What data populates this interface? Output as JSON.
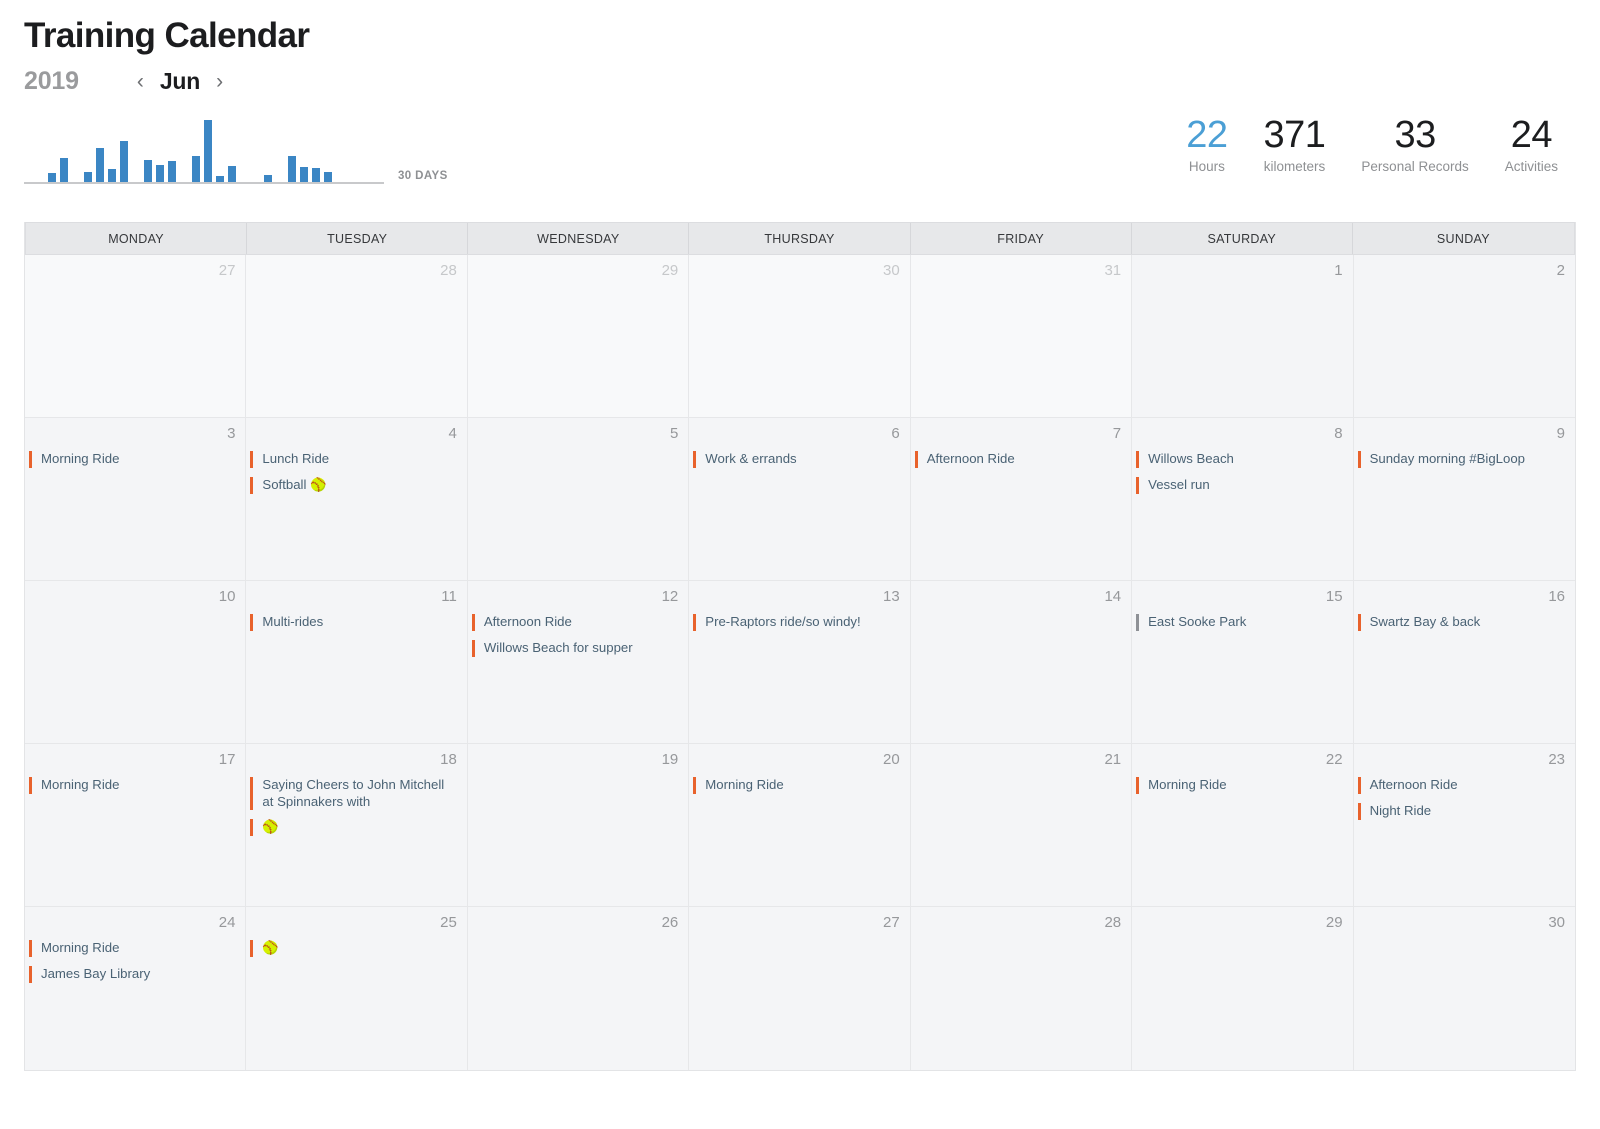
{
  "header": {
    "title": "Training Calendar",
    "year": "2019",
    "month": "Jun",
    "prev_icon": "‹",
    "next_icon": "›",
    "sparkline_label": "30 DAYS"
  },
  "stats": [
    {
      "value": "22",
      "label": "Hours",
      "accent": true,
      "color": "#4b9fd5"
    },
    {
      "value": "371",
      "label": "kilometers",
      "accent": false,
      "color": "#1c1d1f"
    },
    {
      "value": "33",
      "label": "Personal Records",
      "accent": false,
      "color": "#1c1d1f"
    },
    {
      "value": "24",
      "label": "Activities",
      "accent": false,
      "color": "#1c1d1f"
    }
  ],
  "chart_data": {
    "type": "bar",
    "title": "30 DAYS",
    "xlabel": "",
    "ylabel": "",
    "grid": false,
    "legend": "none",
    "categories": [
      "1",
      "2",
      "3",
      "4",
      "5",
      "6",
      "7",
      "8",
      "9",
      "10",
      "11",
      "12",
      "13",
      "14",
      "15",
      "16",
      "17",
      "18",
      "19",
      "20",
      "21",
      "22",
      "23",
      "24",
      "25",
      "26",
      "27",
      "28",
      "29",
      "30"
    ],
    "values": [
      0,
      0,
      8,
      22,
      0,
      9,
      32,
      12,
      38,
      0,
      21,
      16,
      20,
      0,
      24,
      58,
      6,
      15,
      0,
      0,
      7,
      0,
      24,
      14,
      13,
      9,
      0,
      0,
      0,
      0
    ],
    "ylim": [
      0,
      58
    ],
    "color": "#3b86c4"
  },
  "weekdays": [
    "MONDAY",
    "TUESDAY",
    "WEDNESDAY",
    "THURSDAY",
    "FRIDAY",
    "SATURDAY",
    "SUNDAY"
  ],
  "weeks": [
    [
      {
        "num": "27",
        "other": true,
        "events": []
      },
      {
        "num": "28",
        "other": true,
        "events": []
      },
      {
        "num": "29",
        "other": true,
        "events": []
      },
      {
        "num": "30",
        "other": true,
        "events": []
      },
      {
        "num": "31",
        "other": true,
        "events": []
      },
      {
        "num": "1",
        "other": false,
        "events": []
      },
      {
        "num": "2",
        "other": false,
        "events": []
      }
    ],
    [
      {
        "num": "3",
        "other": false,
        "events": [
          {
            "text": "Morning Ride",
            "color": "orange"
          }
        ]
      },
      {
        "num": "4",
        "other": false,
        "events": [
          {
            "text": "Lunch Ride",
            "color": "orange"
          },
          {
            "text": "Softball 🥎",
            "color": "orange"
          }
        ]
      },
      {
        "num": "5",
        "other": false,
        "events": []
      },
      {
        "num": "6",
        "other": false,
        "events": [
          {
            "text": "Work & errands",
            "color": "orange"
          }
        ]
      },
      {
        "num": "7",
        "other": false,
        "events": [
          {
            "text": "Afternoon Ride",
            "color": "orange"
          }
        ]
      },
      {
        "num": "8",
        "other": false,
        "events": [
          {
            "text": "Willows Beach",
            "color": "orange"
          },
          {
            "text": "Vessel run",
            "color": "orange"
          }
        ]
      },
      {
        "num": "9",
        "other": false,
        "events": [
          {
            "text": "Sunday morning #BigLoop",
            "color": "orange"
          }
        ]
      }
    ],
    [
      {
        "num": "10",
        "other": false,
        "events": []
      },
      {
        "num": "11",
        "other": false,
        "events": [
          {
            "text": "Multi-rides",
            "color": "orange"
          }
        ]
      },
      {
        "num": "12",
        "other": false,
        "events": [
          {
            "text": "Afternoon Ride",
            "color": "orange"
          },
          {
            "text": "Willows Beach for supper",
            "color": "orange"
          }
        ]
      },
      {
        "num": "13",
        "other": false,
        "events": [
          {
            "text": "Pre-Raptors ride/so windy!",
            "color": "orange"
          }
        ]
      },
      {
        "num": "14",
        "other": false,
        "events": []
      },
      {
        "num": "15",
        "other": false,
        "events": [
          {
            "text": "East Sooke Park",
            "color": "gray"
          }
        ]
      },
      {
        "num": "16",
        "other": false,
        "events": [
          {
            "text": "Swartz Bay & back",
            "color": "orange"
          }
        ]
      }
    ],
    [
      {
        "num": "17",
        "other": false,
        "events": [
          {
            "text": "Morning Ride",
            "color": "orange"
          }
        ]
      },
      {
        "num": "18",
        "other": false,
        "events": [
          {
            "text": "Saying Cheers to John Mitchell at Spinnakers with",
            "color": "orange"
          },
          {
            "text": "🥎",
            "color": "orange"
          }
        ]
      },
      {
        "num": "19",
        "other": false,
        "events": []
      },
      {
        "num": "20",
        "other": false,
        "events": [
          {
            "text": "Morning Ride",
            "color": "orange"
          }
        ]
      },
      {
        "num": "21",
        "other": false,
        "events": []
      },
      {
        "num": "22",
        "other": false,
        "events": [
          {
            "text": "Morning Ride",
            "color": "orange"
          }
        ]
      },
      {
        "num": "23",
        "other": false,
        "events": [
          {
            "text": "Afternoon Ride",
            "color": "orange"
          },
          {
            "text": "Night Ride",
            "color": "orange"
          }
        ]
      }
    ],
    [
      {
        "num": "24",
        "other": false,
        "events": [
          {
            "text": "Morning Ride",
            "color": "orange"
          },
          {
            "text": "James Bay Library",
            "color": "orange"
          }
        ]
      },
      {
        "num": "25",
        "other": false,
        "events": [
          {
            "text": "🥎",
            "color": "orange"
          }
        ]
      },
      {
        "num": "26",
        "other": false,
        "events": []
      },
      {
        "num": "27",
        "other": false,
        "events": []
      },
      {
        "num": "28",
        "other": false,
        "events": []
      },
      {
        "num": "29",
        "other": false,
        "events": []
      },
      {
        "num": "30",
        "other": false,
        "events": []
      }
    ]
  ]
}
